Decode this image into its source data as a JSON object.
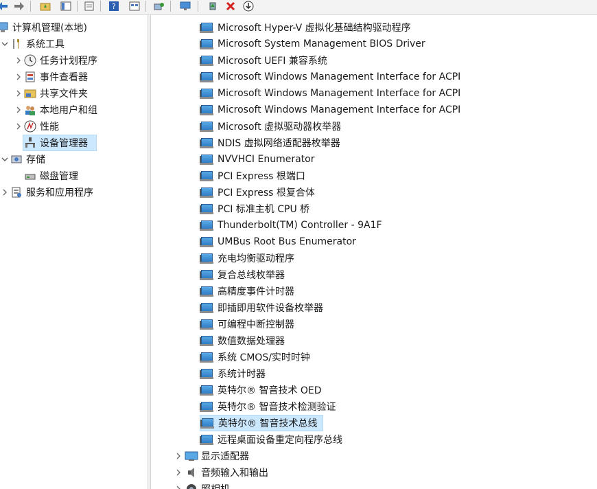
{
  "left_tree": {
    "root": "计算机管理(本地)",
    "system_tools": "系统工具",
    "task_scheduler": "任务计划程序",
    "event_viewer": "事件查看器",
    "shared_folders": "共享文件夹",
    "local_users": "本地用户和组",
    "performance": "性能",
    "device_manager": "设备管理器",
    "storage": "存储",
    "disk_management": "磁盘管理",
    "services_apps": "服务和应用程序"
  },
  "devices": [
    "Microsoft Hyper-V 虚拟化基础结构驱动程序",
    "Microsoft System Management BIOS Driver",
    "Microsoft UEFI 兼容系统",
    "Microsoft Windows Management Interface for ACPI",
    "Microsoft Windows Management Interface for ACPI",
    "Microsoft Windows Management Interface for ACPI",
    "Microsoft 虚拟驱动器枚举器",
    "NDIS 虚拟网络适配器枚举器",
    "NVVHCI Enumerator",
    "PCI Express 根端口",
    "PCI Express 根复合体",
    "PCI 标准主机 CPU 桥",
    "Thunderbolt(TM) Controller - 9A1F",
    "UMBus Root Bus Enumerator",
    "充电均衡驱动程序",
    "复合总线枚举器",
    "高精度事件计时器",
    "即插即用软件设备枚举器",
    "可编程中断控制器",
    "数值数据处理器",
    "系统 CMOS/实时时钟",
    "系统计时器",
    "英特尔® 智音技术 OED",
    "英特尔® 智音技术检测验证",
    "英特尔® 智音技术总线",
    "远程桌面设备重定向程序总线"
  ],
  "categories": {
    "display_adapters": "显示适配器",
    "audio_io": "音频输入和输出",
    "cameras": "照相机"
  }
}
